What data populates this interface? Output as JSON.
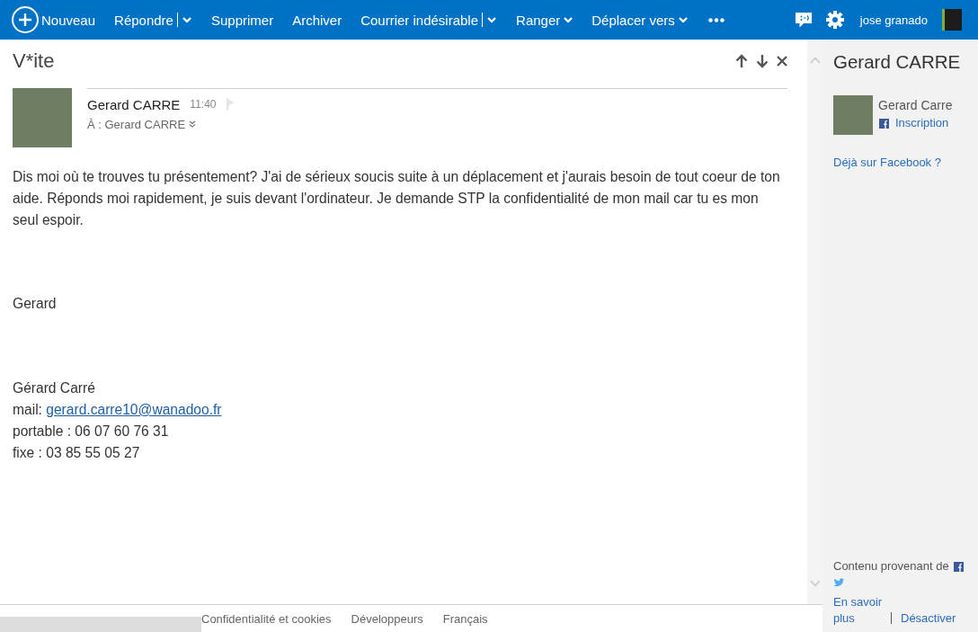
{
  "toolbar": {
    "new_label": "Nouveau",
    "actions": [
      {
        "label": "Répondre",
        "split": true,
        "menu": true
      },
      {
        "label": "Supprimer",
        "split": false,
        "menu": false
      },
      {
        "label": "Archiver",
        "split": false,
        "menu": false
      },
      {
        "label": "Courrier indésirable",
        "split": true,
        "menu": true
      },
      {
        "label": "Ranger",
        "split": false,
        "menu": true
      },
      {
        "label": "Déplacer vers",
        "split": false,
        "menu": true
      }
    ],
    "user_name": "jose granado"
  },
  "message": {
    "subject": "V*ite",
    "sender": "Gerard CARRE",
    "time": "11:40",
    "recipient": "À : Gerard CARRE",
    "paragraphs": [
      "Dis moi où te trouves tu présentement? J'ai de sérieux soucis suite à un déplacement et j'aurais besoin de tout coeur de ton aide. Réponds moi rapidement, je suis devant l'ordinateur. Je demande STP la confidentialité de mon mail car tu es mon seul espoir.",
      "Gerard"
    ],
    "signature": {
      "name": "Gérard Carré",
      "mail_label": "mail:",
      "email": "gerard.carre10@wanadoo.fr",
      "lines": [
        "portable : 06 07 60 76 31",
        "fixe : 03 85 55 05 27"
      ]
    }
  },
  "footer": {
    "links": [
      "Confidentialité et cookies",
      "Développeurs",
      "Français"
    ]
  },
  "people_pane": {
    "title": "Gerard CARRE",
    "contact": {
      "name": "Gerard Carre",
      "action": "Inscription"
    },
    "facebook_prompt": "Déjà sur Facebook ?",
    "source_label": "Contenu provenant de",
    "learn_more": "En savoir plus",
    "disable": "Désactiver"
  }
}
